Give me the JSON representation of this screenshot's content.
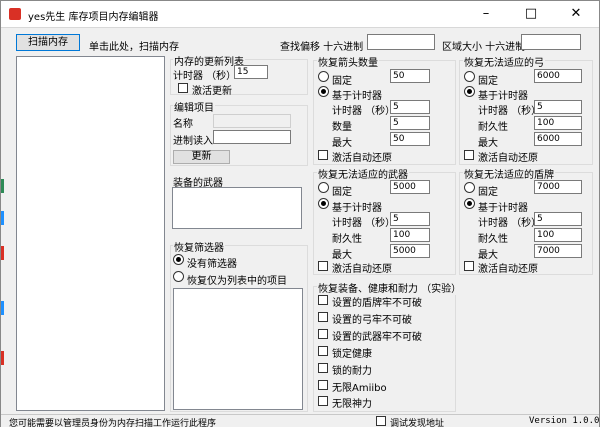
{
  "window": {
    "title": "yes先生 库存项目内存编辑器",
    "minimize_icon": "minimize-icon",
    "maximize_icon": "maximize-icon",
    "close_icon": "close-icon"
  },
  "toolbar": {
    "scan_button": "扫描内存",
    "scan_hint": "单击此处，扫描内存",
    "find_offset_label": "查找偏移 十六进制",
    "find_offset_value": "",
    "region_size_label": "区域大小 十六进制",
    "region_size_value": ""
  },
  "update_list": {
    "title": "内存的更新列表",
    "timer_label": "计时器 （秒）",
    "timer_value": "15",
    "activate_label": "激活更新"
  },
  "edit_item": {
    "title": "编辑项目",
    "name_label": "名称",
    "name_value": "",
    "hex_label": "进制读入",
    "hex_value": "",
    "update_button": "更新"
  },
  "equipped": {
    "title": "装备的武器"
  },
  "restore_filter": {
    "title": "恢复筛选器",
    "no_filter": "没有筛选器",
    "only_list": "恢复仅为列表中的项目"
  },
  "arrows": {
    "title": "恢复箭头数量",
    "fixed_label": "固定",
    "fixed_value": "50",
    "timer_based": "基于计时器",
    "timer_label": "计时器 （秒）",
    "timer_value": "5",
    "qty_label": "数量",
    "qty_value": "5",
    "max_label": "最大",
    "max_value": "50",
    "auto_restore": "激活自动还原"
  },
  "bow": {
    "title": "恢复无法适应的弓",
    "fixed_label": "固定",
    "fixed_value": "6000",
    "timer_based": "基于计时器",
    "timer_label": "计时器 （秒）",
    "timer_value": "5",
    "dur_label": "耐久性",
    "dur_value": "100",
    "max_label": "最大",
    "max_value": "6000",
    "auto_restore": "激活自动还原"
  },
  "weapon": {
    "title": "恢复无法适应的武器",
    "fixed_label": "固定",
    "fixed_value": "5000",
    "timer_based": "基于计时器",
    "timer_label": "计时器 （秒）",
    "timer_value": "5",
    "dur_label": "耐久性",
    "dur_value": "100",
    "max_label": "最大",
    "max_value": "5000",
    "auto_restore": "激活自动还原"
  },
  "shield": {
    "title": "恢复无法适应的盾牌",
    "fixed_label": "固定",
    "fixed_value": "7000",
    "timer_based": "基于计时器",
    "timer_label": "计时器 （秒）",
    "timer_value": "5",
    "dur_label": "耐久性",
    "dur_value": "100",
    "max_label": "最大",
    "max_value": "7000",
    "auto_restore": "激活自动还原"
  },
  "equip_health": {
    "title": "恢复装备、健康和耐力 （实验）",
    "items": [
      "设置的盾牌牢不可破",
      "设置的弓牢不可破",
      "设置的武器牢不可破",
      "锁定健康",
      "锁的耐力",
      "无限Amiibo",
      "无限神力"
    ]
  },
  "status": {
    "admin_note": "您可能需要以管理员身份为内存扫描工作运行此程序",
    "debug_label": "调试发现地址",
    "version": "Version 1.0.0.1"
  }
}
